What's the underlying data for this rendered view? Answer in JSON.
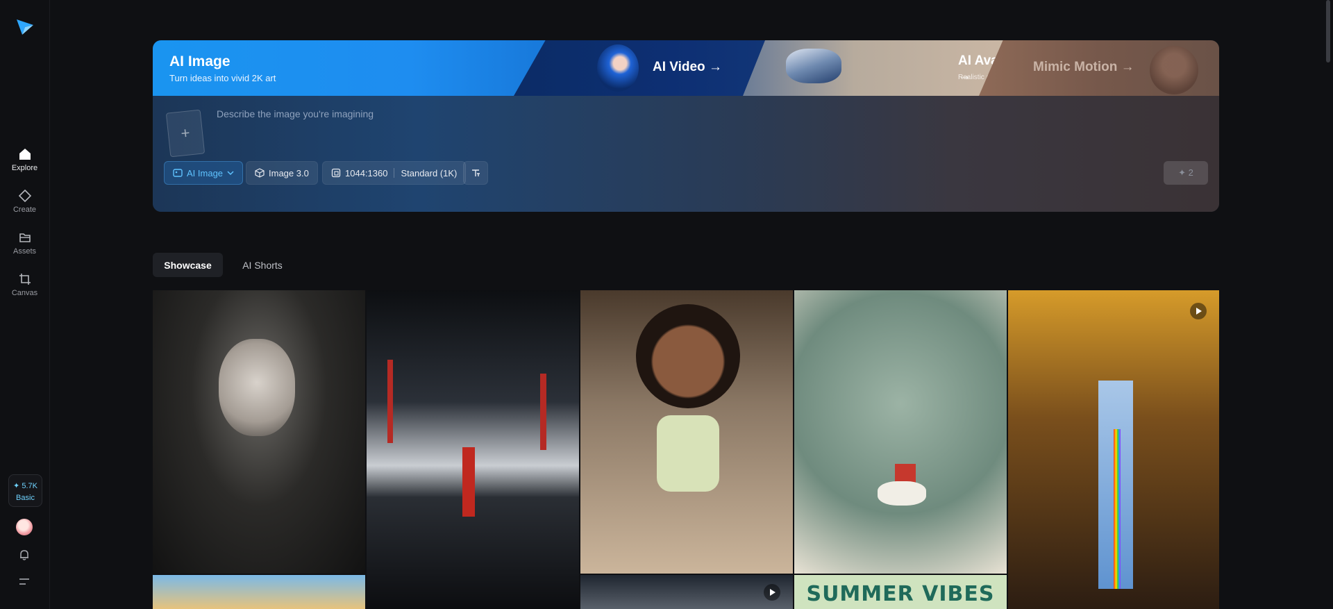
{
  "sidebar": {
    "logo_icon": "paper-plane-logo",
    "items": [
      {
        "label": "Explore",
        "icon": "home-icon",
        "active": true
      },
      {
        "label": "Create",
        "icon": "diamond-icon",
        "active": false
      },
      {
        "label": "Assets",
        "icon": "folder-icon",
        "active": false
      },
      {
        "label": "Canvas",
        "icon": "canvas-crop-icon",
        "active": false
      }
    ],
    "credits": {
      "amount": "✦ 5.7K",
      "plan": "Basic"
    },
    "bell_icon": "bell-icon",
    "menu_icon": "menu-icon"
  },
  "hero": {
    "tabs": [
      {
        "title": "AI Image",
        "subtitle": "Turn ideas into vivid 2K art"
      },
      {
        "title": "AI Video →",
        "subtitle": ""
      },
      {
        "title": "AI Avatar →",
        "subtitle": "Realistic avatars"
      },
      {
        "title": "Mimic Motion →",
        "subtitle": ""
      }
    ],
    "prompt_placeholder": "Describe the image you're imagining",
    "upload_symbol": "+",
    "controls": {
      "mode": "AI Image",
      "model": "Image 3.0",
      "ratio": "1044:1360",
      "quality": "Standard (1K)"
    },
    "generate_cost": "✦ 2",
    "accent": "#1a94f0"
  },
  "showcase": {
    "tabs": [
      {
        "label": "Showcase",
        "active": true
      },
      {
        "label": "AI Shorts",
        "active": false
      }
    ],
    "tiles": [
      {
        "name": "veiled-man-portrait"
      },
      {
        "name": "red-city-reflection"
      },
      {
        "name": "cartoon-girl-drinking"
      },
      {
        "name": "ink-painting-horse"
      },
      {
        "name": "rainbow-door-video",
        "video": true
      },
      {
        "name": "beach-arch-partial"
      },
      {
        "name": "storm-clouds-video",
        "video": true
      },
      {
        "name": "summer-vibes-poster",
        "text": "SUMMER VIBES"
      }
    ]
  }
}
